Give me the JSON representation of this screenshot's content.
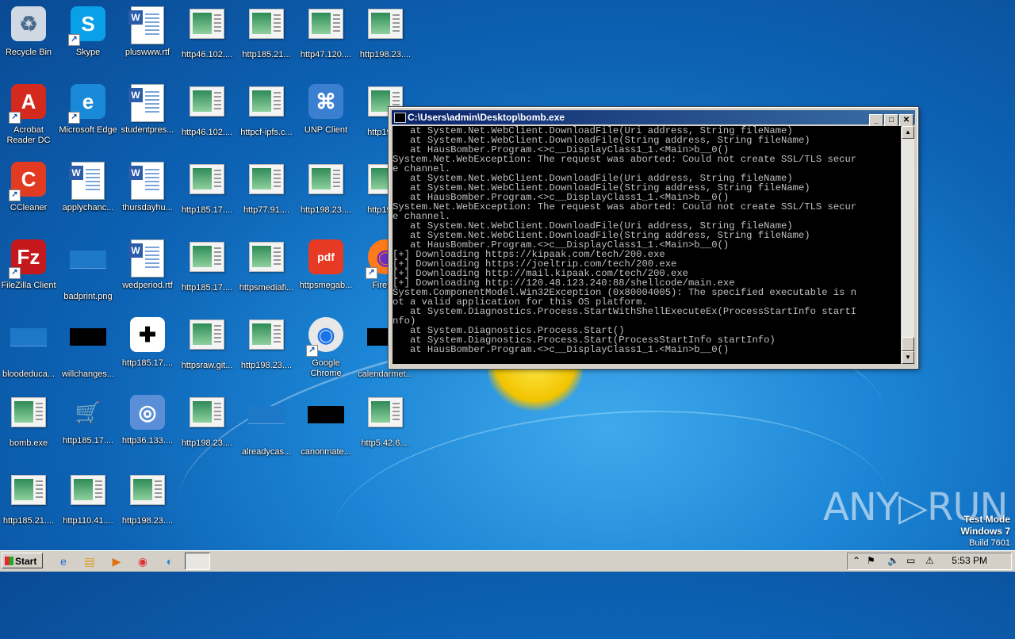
{
  "desktop": {
    "icons": [
      {
        "label": "Recycle Bin",
        "icon": "recycle-bin-icon"
      },
      {
        "label": "Skype",
        "icon": "skype-icon"
      },
      {
        "label": "pluswww.rtf",
        "icon": "word-document-icon"
      },
      {
        "label": "http46.102....",
        "icon": "html-file-icon"
      },
      {
        "label": "http185.21...",
        "icon": "html-file-icon"
      },
      {
        "label": "http47.120....",
        "icon": "html-file-icon"
      },
      {
        "label": "http198.23....",
        "icon": "html-file-icon"
      },
      {
        "label": "Acrobat Reader DC",
        "icon": "acrobat-icon"
      },
      {
        "label": "Microsoft Edge",
        "icon": "edge-icon"
      },
      {
        "label": "studentpres...",
        "icon": "word-document-icon"
      },
      {
        "label": "http46.102....",
        "icon": "html-file-icon"
      },
      {
        "label": "httpcf-ipfs.c...",
        "icon": "html-file-icon"
      },
      {
        "label": "UNP Client",
        "icon": "network-icon"
      },
      {
        "label": "http198...",
        "icon": "html-file-icon"
      },
      {
        "label": "CCleaner",
        "icon": "ccleaner-icon"
      },
      {
        "label": "applychanc...",
        "icon": "word-document-icon"
      },
      {
        "label": "thursdayhu...",
        "icon": "word-document-icon"
      },
      {
        "label": "http185.17....",
        "icon": "html-file-icon"
      },
      {
        "label": "http77.91....",
        "icon": "html-file-icon"
      },
      {
        "label": "http198.23....",
        "icon": "html-file-icon"
      },
      {
        "label": "http198...",
        "icon": "html-file-icon"
      },
      {
        "label": "FileZilla Client",
        "icon": "filezilla-icon"
      },
      {
        "label": "badprint.png",
        "icon": "image-file-icon"
      },
      {
        "label": "wedperiod.rtf",
        "icon": "word-document-icon"
      },
      {
        "label": "http185.17....",
        "icon": "html-file-shield-icon"
      },
      {
        "label": "httpsmediafi...",
        "icon": "html-file-icon"
      },
      {
        "label": "httpsmegab...",
        "icon": "pdf-icon"
      },
      {
        "label": "Firefox",
        "icon": "firefox-icon"
      },
      {
        "label": "bloodeduca...",
        "icon": "image-file-icon"
      },
      {
        "label": "willchanges...",
        "icon": "image-file-icon"
      },
      {
        "label": "http185.17....",
        "icon": "medicine-jar-icon"
      },
      {
        "label": "httpsraw.git...",
        "icon": "html-file-icon"
      },
      {
        "label": "http198.23....",
        "icon": "html-file-icon"
      },
      {
        "label": "Google Chrome",
        "icon": "chrome-icon"
      },
      {
        "label": "calendarmet...",
        "icon": "image-file-icon"
      },
      {
        "label": "bomb.exe",
        "icon": "html-file-icon"
      },
      {
        "label": "http185.17....",
        "icon": "shopping-cart-icon"
      },
      {
        "label": "http36.133....",
        "icon": "computer-disc-icon"
      },
      {
        "label": "http198.23....",
        "icon": "html-file-icon"
      },
      {
        "label": "alreadycas...",
        "icon": "image-file-icon"
      },
      {
        "label": "canonmate...",
        "icon": "image-file-icon"
      },
      {
        "label": "http5.42.6....",
        "icon": "html-file-icon"
      },
      {
        "label": "http185.21....",
        "icon": "html-file-icon"
      },
      {
        "label": "http110.41....",
        "icon": "html-file-icon"
      },
      {
        "label": "http198.23....",
        "icon": "html-file-icon"
      }
    ]
  },
  "console": {
    "title": "C:\\Users\\admin\\Desktop\\bomb.exe",
    "lines": [
      "   at System.Net.WebClient.DownloadFile(Uri address, String fileName)",
      "   at System.Net.WebClient.DownloadFile(String address, String fileName)",
      "   at HausBomber.Program.<>c__DisplayClass1_1.<Main>b__0()",
      "System.Net.WebException: The request was aborted: Could not create SSL/TLS secur",
      "e channel.",
      "   at System.Net.WebClient.DownloadFile(Uri address, String fileName)",
      "   at System.Net.WebClient.DownloadFile(String address, String fileName)",
      "   at HausBomber.Program.<>c__DisplayClass1_1.<Main>b__0()",
      "System.Net.WebException: The request was aborted: Could not create SSL/TLS secur",
      "e channel.",
      "   at System.Net.WebClient.DownloadFile(Uri address, String fileName)",
      "   at System.Net.WebClient.DownloadFile(String address, String fileName)",
      "   at HausBomber.Program.<>c__DisplayClass1_1.<Main>b__0()",
      "[+] Downloading https://kipaak.com/tech/200.exe",
      "[+] Downloading https://joeltrip.com/tech/200.exe",
      "[+] Downloading http://mail.kipaak.com/tech/200.exe",
      "[+] Downloading http://120.48.123.240:88/shellcode/main.exe",
      "System.ComponentModel.Win32Exception (0x80004005): The specified executable is n",
      "ot a valid application for this OS platform.",
      "   at System.Diagnostics.Process.StartWithShellExecuteEx(ProcessStartInfo startI",
      "nfo)",
      "   at System.Diagnostics.Process.Start()",
      "   at System.Diagnostics.Process.Start(ProcessStartInfo startInfo)",
      "   at HausBomber.Program.<>c__DisplayClass1_1.<Main>b__0()"
    ]
  },
  "watermark": {
    "brand": "ANY▷RUN",
    "test_mode": "Test Mode",
    "os": "Windows 7",
    "build": "Build 7601"
  },
  "taskbar": {
    "start_label": "Start",
    "clock": "5:53 PM"
  }
}
